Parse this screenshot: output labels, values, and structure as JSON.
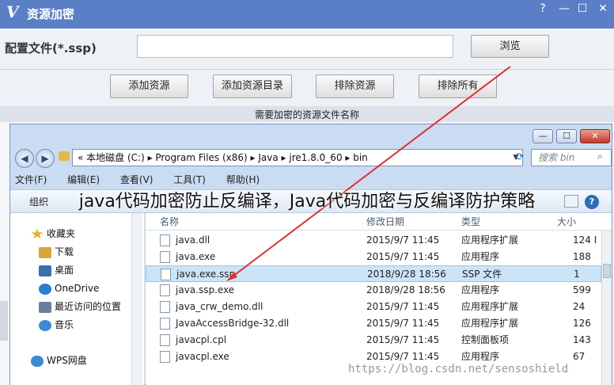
{
  "app": {
    "logo": "V",
    "title": "资源加密",
    "window_buttons": [
      "?",
      "—",
      "☐",
      "✕"
    ]
  },
  "config": {
    "label": "配置文件(*.ssp)",
    "input_value": "",
    "browse_label": "浏览"
  },
  "actions": [
    "添加资源",
    "添加资源目录",
    "排除资源",
    "排除所有"
  ],
  "list_header": "需要加密的资源文件名称",
  "explorer": {
    "window_buttons": [
      "—",
      "☐",
      "✕"
    ],
    "address": "« 本地磁盘 (C:) ▸ Program Files (x86) ▸ Java ▸ jre1.8.0_60 ▸ bin",
    "search_placeholder": "搜索 bin",
    "menu": [
      "文件(F)",
      "编辑(E)",
      "查看(V)",
      "工具(T)",
      "帮助(H)"
    ],
    "toolbar_label": "组织",
    "nav_items": [
      {
        "label": "收藏夹",
        "icon": "star-icon",
        "color": "#e8b21f"
      },
      {
        "label": "下载",
        "icon": "download-folder-icon",
        "color": "#d9a43a"
      },
      {
        "label": "桌面",
        "icon": "desktop-icon",
        "color": "#3a6fb0"
      },
      {
        "label": "OneDrive",
        "icon": "onedrive-icon",
        "color": "#2a7bd6"
      },
      {
        "label": "最近访问的位置",
        "icon": "recent-places-icon",
        "color": "#6c7f9a"
      },
      {
        "label": "音乐",
        "icon": "music-icon",
        "color": "#3b8ad6"
      },
      {
        "label": "WPS网盘",
        "icon": "cloud-icon",
        "color": "#3b8ad6"
      }
    ],
    "columns": [
      "名称",
      "修改日期",
      "类型",
      "大小"
    ],
    "files": [
      {
        "name": "java.dll",
        "date": "2015/9/7 11:45",
        "type": "应用程序扩展",
        "size": "124 I"
      },
      {
        "name": "java.exe",
        "date": "2015/9/7 11:45",
        "type": "应用程序",
        "size": "188"
      },
      {
        "name": "java.exe.ssp",
        "date": "2018/9/28 18:56",
        "type": "SSP 文件",
        "size": "1"
      },
      {
        "name": "java.ssp.exe",
        "date": "2018/9/28 18:56",
        "type": "应用程序",
        "size": "599"
      },
      {
        "name": "java_crw_demo.dll",
        "date": "2015/9/7 11:45",
        "type": "应用程序扩展",
        "size": "24"
      },
      {
        "name": "JavaAccessBridge-32.dll",
        "date": "2015/9/7 11:45",
        "type": "应用程序扩展",
        "size": "126"
      },
      {
        "name": "javacpl.cpl",
        "date": "2015/9/7 11:45",
        "type": "控制面板项",
        "size": "143"
      },
      {
        "name": "javacpl.exe",
        "date": "2015/9/7 11:45",
        "type": "应用程序",
        "size": "67"
      }
    ]
  },
  "overlay_title": "java代码加密防止反编译，Java代码加密与反编译防护策略",
  "watermark": "https://blog.csdn.net/sensoshield",
  "colors": {
    "accent": "#5b7fc7",
    "arrow": "#e0302e",
    "selection": "#cce4f7"
  }
}
